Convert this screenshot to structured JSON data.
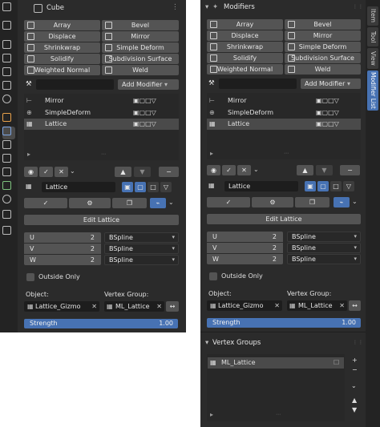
{
  "left": {
    "object_name": "Cube",
    "modifiers_grid": [
      [
        "Array",
        "Bevel"
      ],
      [
        "Displace",
        "Mirror"
      ],
      [
        "Shrinkwrap",
        "Simple Deform"
      ],
      [
        "Solidify",
        "Subdivision Surface"
      ],
      [
        "Weighted Normal",
        "Weld"
      ]
    ],
    "add_modifier": "Add Modifier",
    "stack": [
      "Mirror",
      "SimpleDeform",
      "Lattice"
    ],
    "lattice_name": "Lattice",
    "edit_lattice": "Edit Lattice",
    "uvw": [
      {
        "key": "U",
        "value": "2",
        "interp": "BSpline"
      },
      {
        "key": "V",
        "value": "2",
        "interp": "BSpline"
      },
      {
        "key": "W",
        "value": "2",
        "interp": "BSpline"
      }
    ],
    "outside_only": "Outside Only",
    "object_label": "Object:",
    "object_value": "Lattice_Gizmo",
    "vgroup_label": "Vertex Group:",
    "vgroup_value": "ML_Lattice",
    "strength_label": "Strength",
    "strength_value": "1.00"
  },
  "right": {
    "header": "Modifiers",
    "modifiers_grid": [
      [
        "Array",
        "Bevel"
      ],
      [
        "Displace",
        "Mirror"
      ],
      [
        "Shrinkwrap",
        "Simple Deform"
      ],
      [
        "Solidify",
        "Subdivision Surface"
      ],
      [
        "Weighted Normal",
        "Weld"
      ]
    ],
    "add_modifier": "Add Modifier",
    "stack": [
      "Mirror",
      "SimpleDeform",
      "Lattice"
    ],
    "lattice_name": "Lattice",
    "edit_lattice": "Edit Lattice",
    "uvw": [
      {
        "key": "U",
        "value": "2",
        "interp": "BSpline"
      },
      {
        "key": "V",
        "value": "2",
        "interp": "BSpline"
      },
      {
        "key": "W",
        "value": "2",
        "interp": "BSpline"
      }
    ],
    "outside_only": "Outside Only",
    "object_label": "Object:",
    "object_value": "Lattice_Gizmo",
    "vgroup_label": "Vertex Group:",
    "vgroup_value": "ML_Lattice",
    "strength_label": "Strength",
    "strength_value": "1.00",
    "vertex_groups_header": "Vertex Groups",
    "vertex_group_item": "ML_Lattice",
    "tabs": [
      "Item",
      "Tool",
      "View",
      "Modifier List"
    ]
  },
  "colors": {
    "accent": "#4772b3",
    "panel": "#2b2b2b",
    "field": "#1d1d1d",
    "button": "#545454"
  }
}
